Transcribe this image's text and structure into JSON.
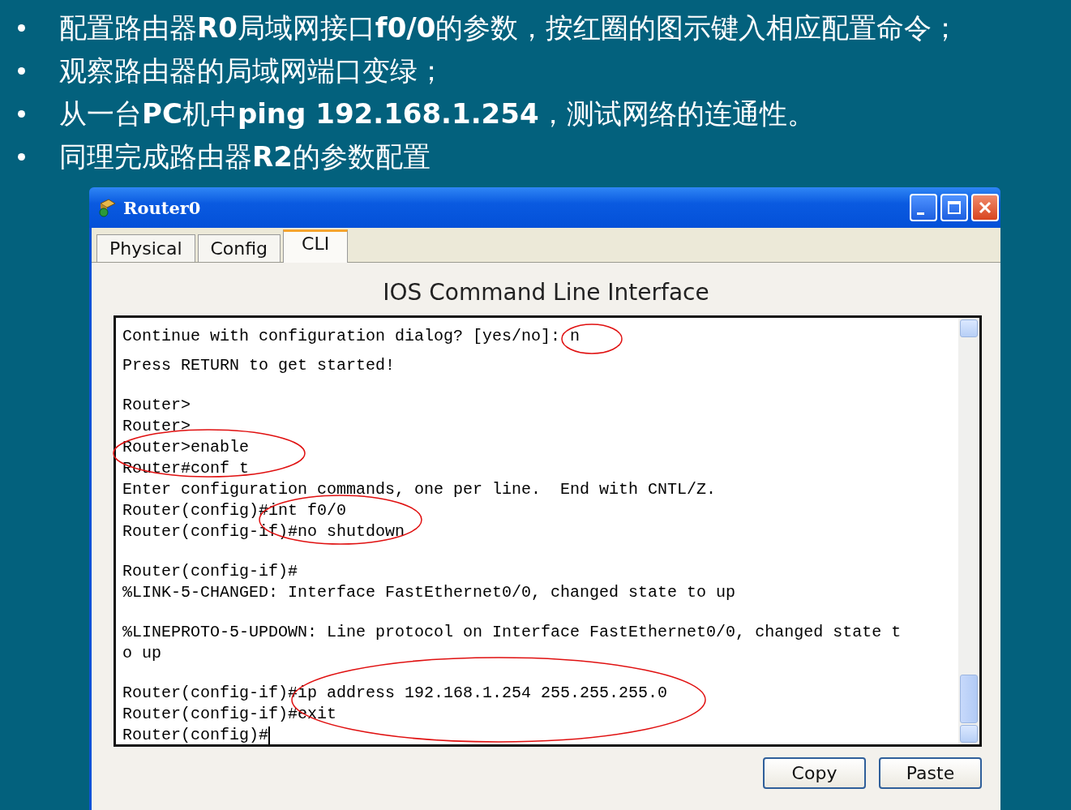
{
  "bullets": [
    "配置路由器**R0**局域网接口**f0/0**的参数，按红圈的图示键入相应配置命令；",
    "观察路由器的局域网端口变绿；",
    "从一台**PC**机中**ping 192.168.1.254**，测试网络的连通性。",
    "同理完成路由器**R2**的参数配置"
  ],
  "window": {
    "title": "Router0",
    "tabs": [
      {
        "label": "Physical",
        "selected": false
      },
      {
        "label": "Config",
        "selected": false
      },
      {
        "label": "CLI",
        "selected": true
      }
    ],
    "heading": "IOS Command Line Interface",
    "terminal": {
      "blocks": [
        [
          "Continue with configuration dialog? [yes/no]: n"
        ],
        [
          "Press RETURN to get started!"
        ],
        [
          "Router>",
          "Router>",
          "Router>enable",
          "Router#conf t",
          "Enter configuration commands, one per line.  End with CNTL/Z.",
          "Router(config)#int f0/0",
          "Router(config-if)#no shutdown"
        ],
        [
          "Router(config-if)#",
          "%LINK-5-CHANGED: Interface FastEthernet0/0, changed state to up"
        ],
        [
          "%LINEPROTO-5-UPDOWN: Line protocol on Interface FastEthernet0/0, changed state t",
          "o up"
        ],
        [
          "Router(config-if)#ip address 192.168.1.254 255.255.255.0",
          "Router(config-if)#exit",
          "Router(config)#"
        ]
      ]
    },
    "buttons": [
      "Copy",
      "Paste"
    ]
  }
}
